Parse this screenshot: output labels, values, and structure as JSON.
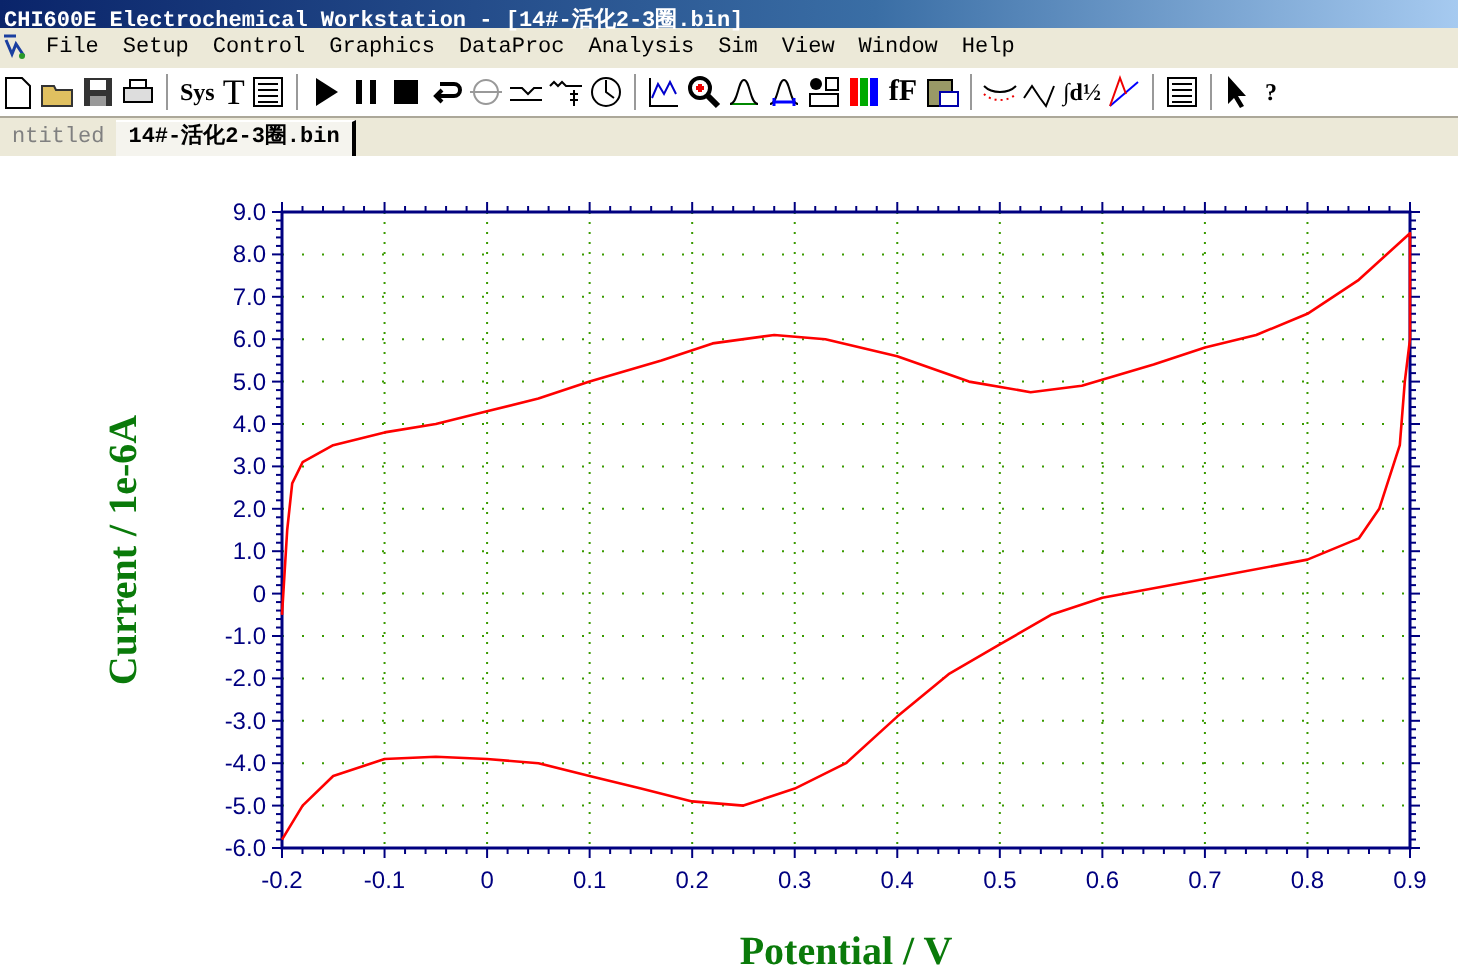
{
  "window": {
    "title": "CHI600E Electrochemical Workstation - [14#-活化2-3圈.bin]"
  },
  "menu": [
    "File",
    "Setup",
    "Control",
    "Graphics",
    "DataProc",
    "Analysis",
    "Sim",
    "View",
    "Window",
    "Help"
  ],
  "toolbar": {
    "glyphs": [
      "Sys",
      "T",
      "fF",
      "∫d½",
      "?"
    ]
  },
  "tabs": [
    {
      "label": "ntitled",
      "selected": false
    },
    {
      "label": "14#-活化2-3圈.bin",
      "selected": true
    }
  ],
  "plot": {
    "chart_data": {
      "type": "line",
      "grid": true,
      "xlabel": "Potential / V",
      "ylabel": "Current / 1e-6A",
      "xlim": [
        -0.2,
        0.9
      ],
      "ylim": [
        -6,
        9
      ],
      "xticks": [
        {
          "value": -0.2,
          "label": "-0.2"
        },
        {
          "value": -0.1,
          "label": "-0.1"
        },
        {
          "value": 0,
          "label": "0"
        },
        {
          "value": 0.1,
          "label": "0.1"
        },
        {
          "value": 0.2,
          "label": "0.2"
        },
        {
          "value": 0.3,
          "label": "0.3"
        },
        {
          "value": 0.4,
          "label": "0.4"
        },
        {
          "value": 0.5,
          "label": "0.5"
        },
        {
          "value": 0.6,
          "label": "0.6"
        },
        {
          "value": 0.7,
          "label": "0.7"
        },
        {
          "value": 0.8,
          "label": "0.8"
        },
        {
          "value": 0.9,
          "label": "0.9"
        }
      ],
      "yticks": [
        {
          "value": 9,
          "label": "9.0"
        },
        {
          "value": 8,
          "label": "8.0"
        },
        {
          "value": 7,
          "label": "7.0"
        },
        {
          "value": 6,
          "label": "6.0"
        },
        {
          "value": 5,
          "label": "5.0"
        },
        {
          "value": 4,
          "label": "4.0"
        },
        {
          "value": 3,
          "label": "3.0"
        },
        {
          "value": 2,
          "label": "2.0"
        },
        {
          "value": 1,
          "label": "1.0"
        },
        {
          "value": 0,
          "label": "0"
        },
        {
          "value": -1,
          "label": "-1.0"
        },
        {
          "value": -2,
          "label": "-2.0"
        },
        {
          "value": -3,
          "label": "-3.0"
        },
        {
          "value": -4,
          "label": "-4.0"
        },
        {
          "value": -5,
          "label": "-5.0"
        },
        {
          "value": -6,
          "label": "-6.0"
        }
      ],
      "x": [
        -0.2,
        -0.195,
        -0.19,
        -0.18,
        -0.15,
        -0.1,
        -0.05,
        0,
        0.05,
        0.1,
        0.17,
        0.22,
        0.28,
        0.33,
        0.4,
        0.47,
        0.53,
        0.58,
        0.65,
        0.7,
        0.75,
        0.8,
        0.85,
        0.9,
        0.9,
        0.895,
        0.89,
        0.87,
        0.85,
        0.8,
        0.7,
        0.6,
        0.55,
        0.5,
        0.45,
        0.4,
        0.35,
        0.3,
        0.25,
        0.2,
        0.15,
        0.1,
        0.05,
        0,
        -0.05,
        -0.1,
        -0.15,
        -0.18,
        -0.2
      ],
      "series": [
        {
          "color": "#ff0000",
          "values": [
            -0.5,
            1.5,
            2.6,
            3.1,
            3.5,
            3.8,
            4.0,
            4.3,
            4.6,
            5.0,
            5.5,
            5.9,
            6.1,
            6.0,
            5.6,
            5.0,
            4.75,
            4.9,
            5.4,
            5.8,
            6.1,
            6.6,
            7.4,
            8.5,
            6.0,
            5.0,
            3.5,
            2.0,
            1.3,
            0.8,
            0.35,
            -0.1,
            -0.5,
            -1.2,
            -1.9,
            -2.9,
            -4.0,
            -4.6,
            -5.0,
            -4.9,
            -4.6,
            -4.3,
            -4.0,
            -3.9,
            -3.85,
            -3.9,
            -4.3,
            -5.0,
            -5.8
          ]
        }
      ]
    }
  }
}
